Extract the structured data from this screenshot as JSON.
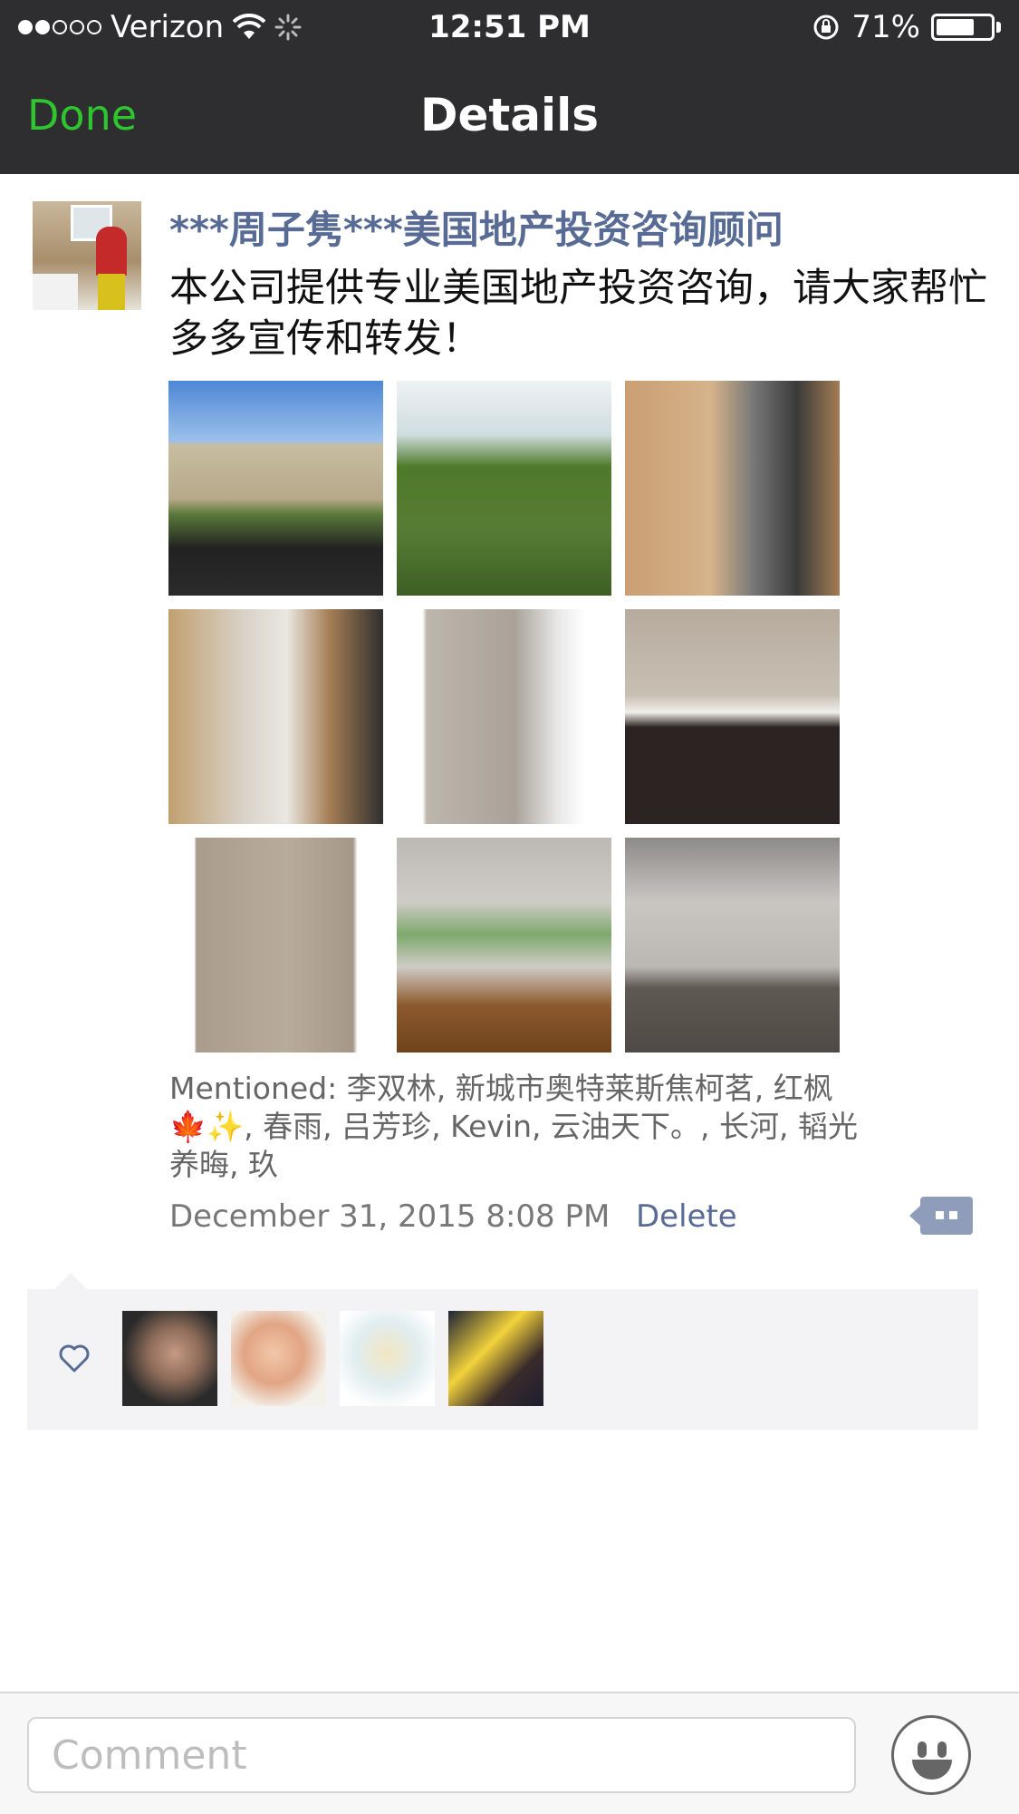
{
  "status_bar": {
    "carrier": "Verizon",
    "time": "12:51 PM",
    "battery": "71%",
    "battery_level": 0.71,
    "signal_filled_dots": 2,
    "signal_total_dots": 5
  },
  "nav": {
    "done_label": "Done",
    "title": "Details"
  },
  "post": {
    "username": "***周子隽***美国地产投资咨询顾问",
    "content": "本公司提供专业美国地产投资咨询，请大家帮忙多多宣传和转发！",
    "photo_count": 9,
    "mentioned": "Mentioned: 李双林, 新城市奥特莱斯焦柯茗, 红枫🍁✨, 春雨, 吕芳珍, Kevin, 云油天下。, 长河, 韬光养晦, 玖",
    "timestamp": "December 31, 2015 8:08 PM",
    "delete_label": "Delete"
  },
  "likes": {
    "count": 4
  },
  "composer": {
    "placeholder": "Comment"
  },
  "colors": {
    "header_bg": "#2e2e31",
    "done_green": "#2ec52e",
    "link_blue": "#576b95",
    "likes_bg": "#f3f3f5"
  },
  "icons": {
    "signal": "signal-dots-icon",
    "wifi": "wifi-icon",
    "activity": "activity-spinner-icon",
    "rotation_lock": "rotation-lock-icon",
    "battery": "battery-icon",
    "comment_action": "comment-bubble-icon",
    "heart": "heart-icon",
    "emoji": "emoji-icon"
  }
}
